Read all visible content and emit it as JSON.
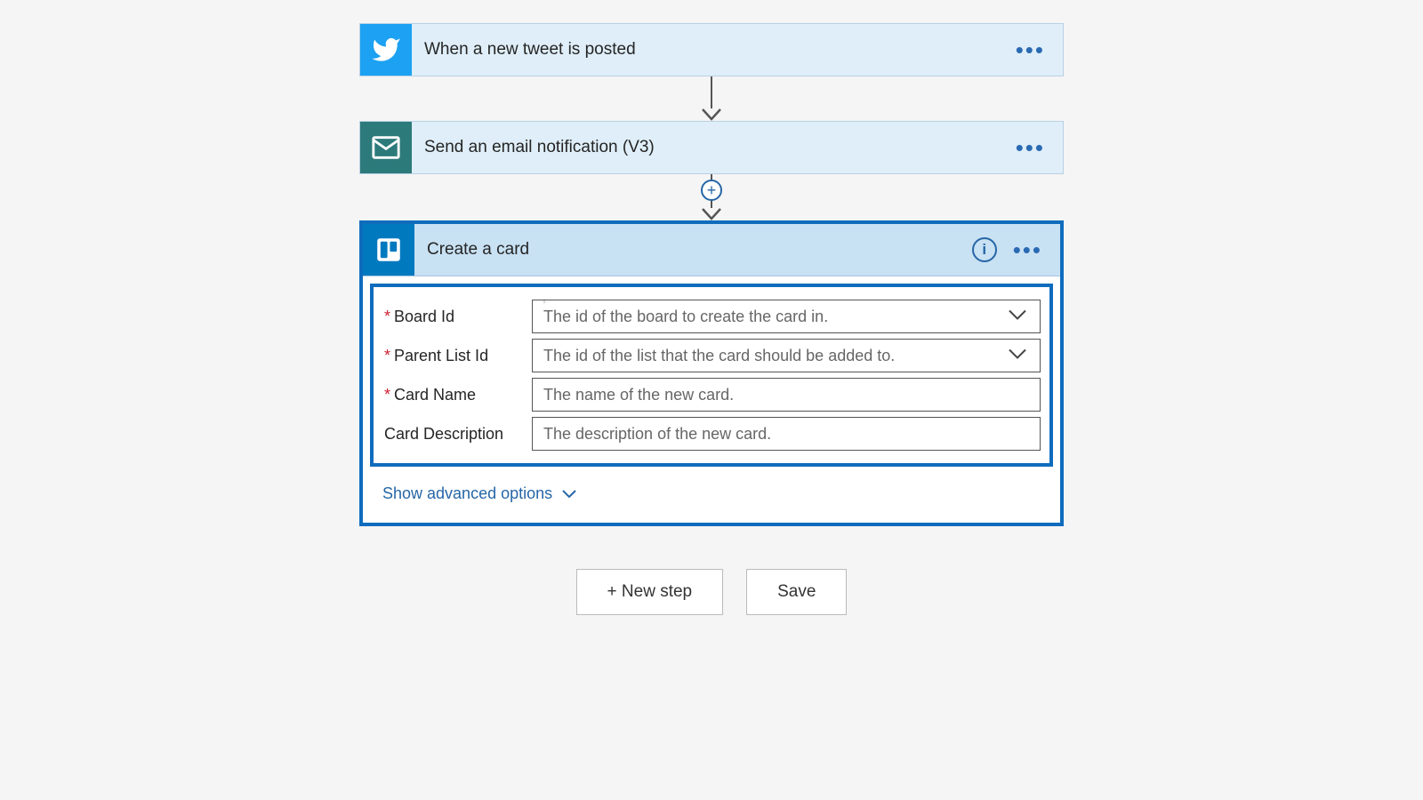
{
  "steps": {
    "twitter": {
      "title": "When a new tweet is posted"
    },
    "mail": {
      "title": "Send an email notification (V3)"
    },
    "trello": {
      "title": "Create a card"
    }
  },
  "form": {
    "board_id": {
      "label": "Board Id",
      "placeholder": "The id of the board to create the card in.",
      "required": true
    },
    "parent_list": {
      "label": "Parent List Id",
      "placeholder": "The id of the list that the card should be added to.",
      "required": true
    },
    "card_name": {
      "label": "Card Name",
      "placeholder": "The name of the new card.",
      "required": true
    },
    "card_desc": {
      "label": "Card Description",
      "placeholder": "The description of the new card.",
      "required": false
    }
  },
  "advanced_label": "Show advanced options",
  "footer": {
    "new_step": "+ New step",
    "save": "Save"
  }
}
